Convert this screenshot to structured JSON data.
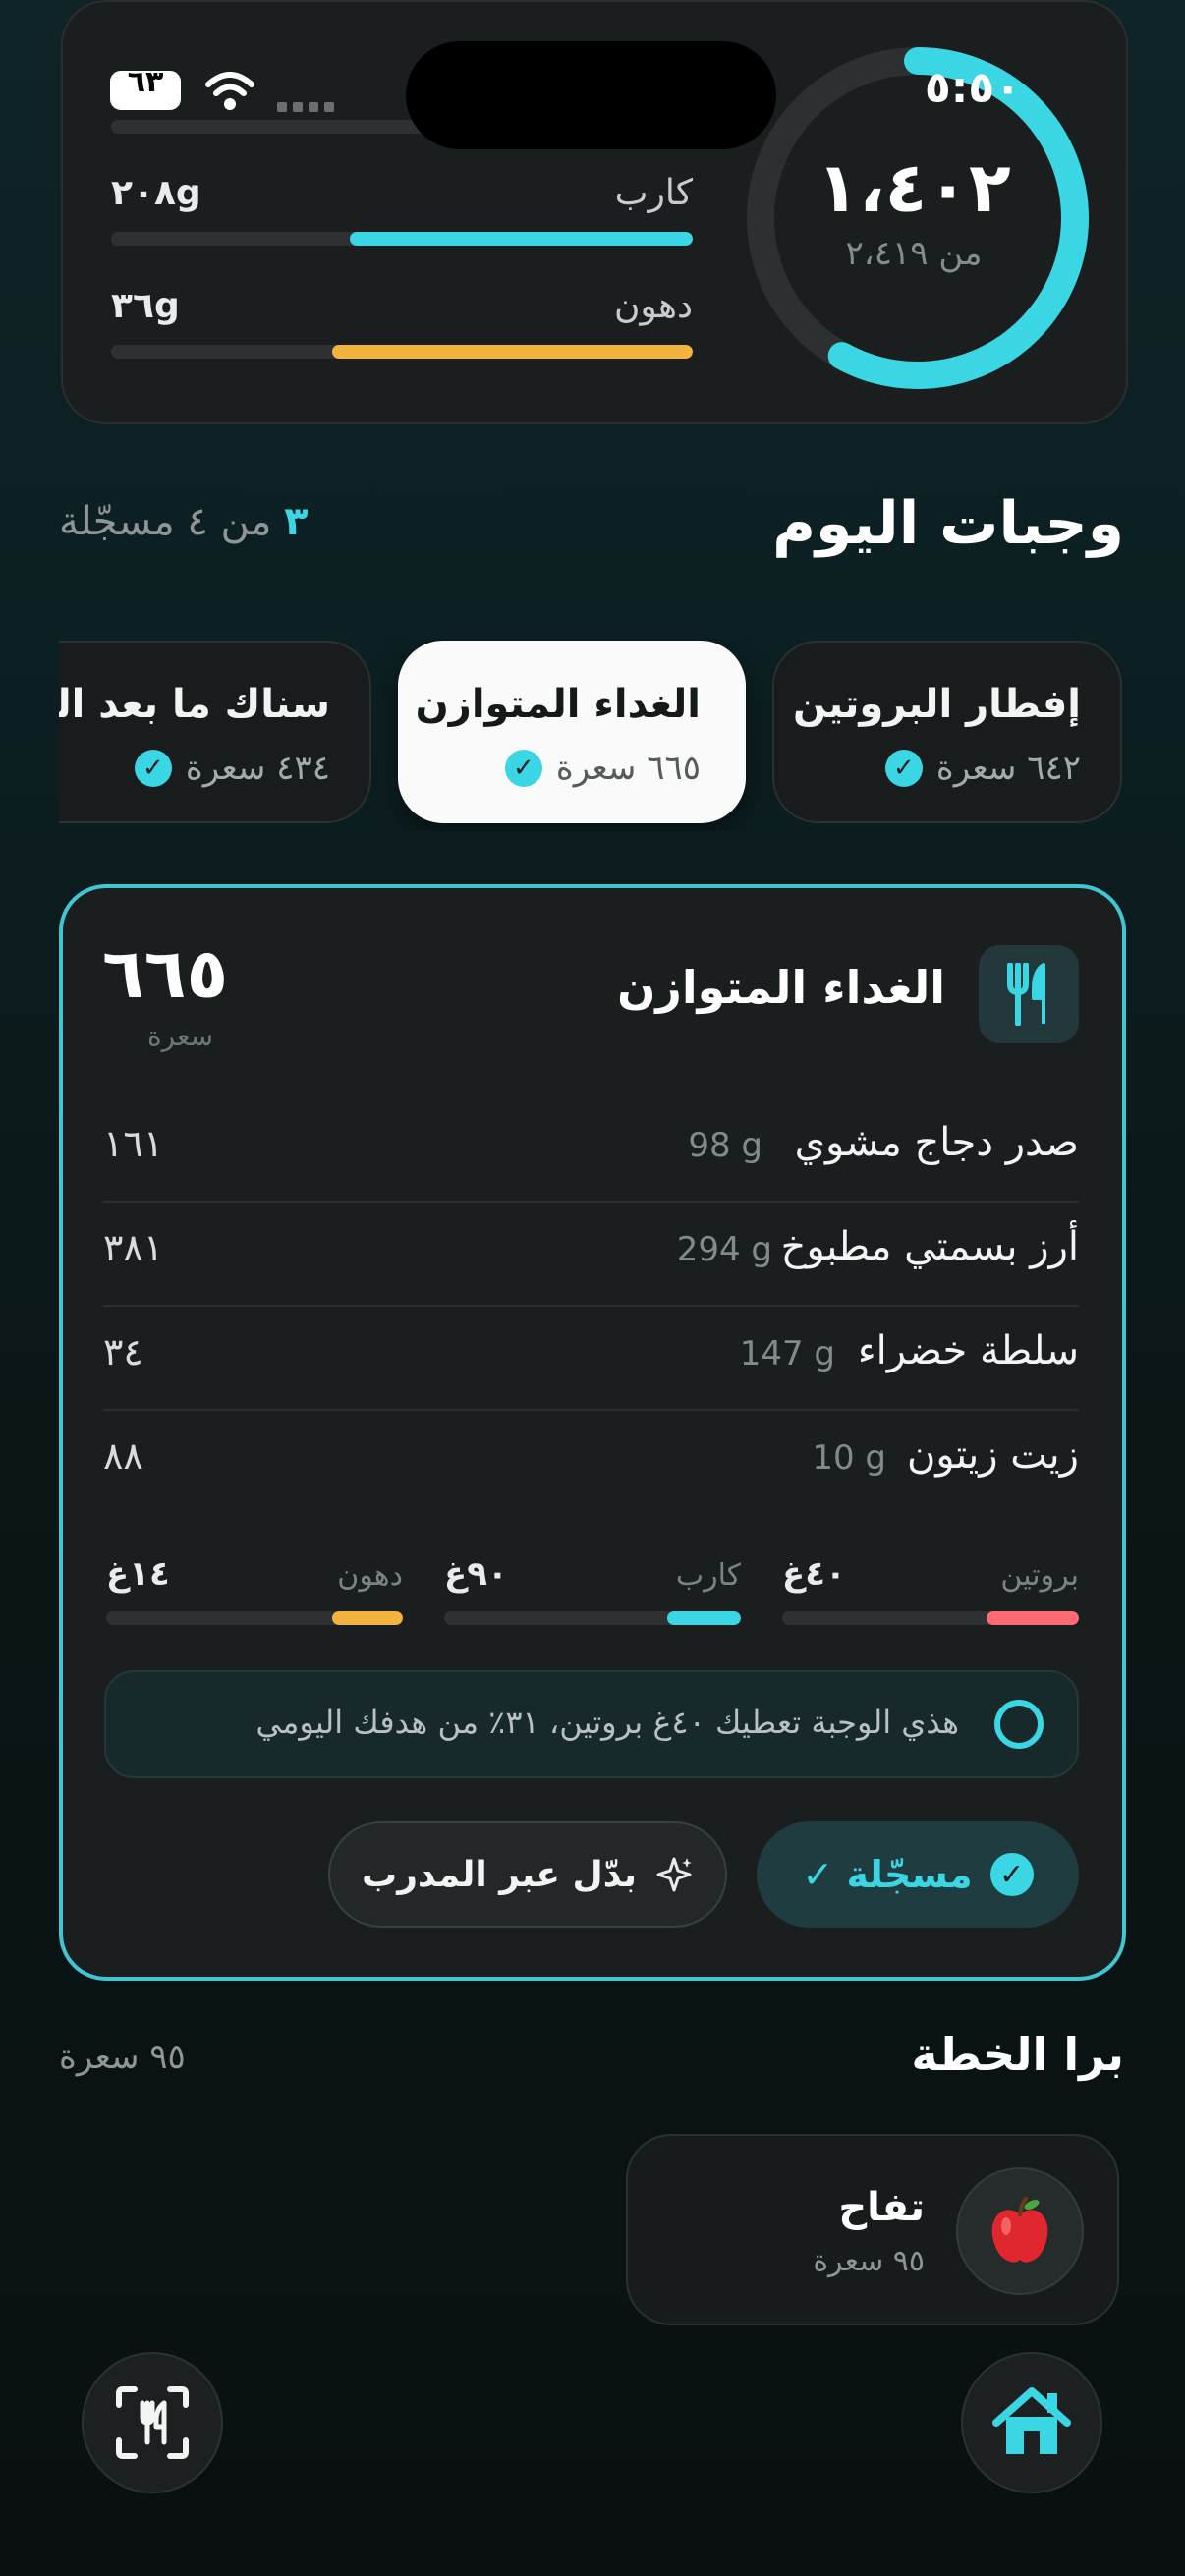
{
  "status": {
    "time": "٥:٥٠",
    "battery": "٦٣"
  },
  "summary": {
    "calories_value": "١،٤٠٢",
    "calories_target": "من ٢،٤١٩",
    "calories_progress": 0.58,
    "macros": [
      {
        "label": "كارب",
        "value": "٢٠٨g",
        "fill": 0.59,
        "color": "#3ad6e4"
      },
      {
        "label": "دهون",
        "value": "٣٦g",
        "fill": 0.62,
        "color": "#f2b43f"
      }
    ],
    "protein_bar_color": "#ff6b74"
  },
  "today": {
    "title": "وجبات اليوم",
    "count_number": "٣",
    "count_text": "من ٤ مسجّلة"
  },
  "meal_tabs": [
    {
      "title": "إفطار البروتين",
      "calories": "٦٤٢ سعرة",
      "checked": true,
      "active": false
    },
    {
      "title": "الغداء المتوازن",
      "calories": "٦٦٥ سعرة",
      "checked": true,
      "active": true
    },
    {
      "title": "سناك ما بعد التمرين",
      "calories": "٤٣٤ سعرة",
      "checked": true,
      "active": false
    }
  ],
  "meal": {
    "icon": "fork-knife-icon",
    "title": "الغداء المتوازن",
    "calories": "٦٦٥",
    "calories_unit": "سعرة",
    "foods": [
      {
        "name": "صدر دجاج مشوي",
        "grams": "98 g",
        "calories": "١٦١"
      },
      {
        "name": "أرز بسمتي مطبوخ",
        "grams": "294 g",
        "calories": "٣٨١"
      },
      {
        "name": "سلطة خضراء",
        "grams": "147 g",
        "calories": "٣٤"
      },
      {
        "name": "زيت زيتون",
        "grams": "10 g",
        "calories": "٨٨"
      }
    ],
    "macros": [
      {
        "label": "بروتين",
        "value": "٤٠غ",
        "fill": 0.31,
        "color": "#ff6b74"
      },
      {
        "label": "كارب",
        "value": "٩٠غ",
        "fill": 0.25,
        "color": "#3ad6e4"
      },
      {
        "label": "دهون",
        "value": "١٤غ",
        "fill": 0.24,
        "color": "#f2b43f"
      }
    ],
    "insight": "هذي الوجبة تعطيك ٤٠غ بروتين، ٣١٪ من هدفك اليومي",
    "logged_label": "مسجّلة ✓",
    "swap_label": "بدّل عبر المدرب"
  },
  "extras": {
    "title": "برا الخطة",
    "total": "٩٥ سعرة",
    "items": [
      {
        "name": "تفاح",
        "calories": "٩٥ سعرة",
        "emoji": "🍎"
      }
    ]
  },
  "nav": {
    "left_icon": "scan-food-icon",
    "right_icon": "home-icon"
  },
  "colors": {
    "accent": "#3ad6e4",
    "protein": "#ff6b74",
    "fat": "#f2b43f"
  }
}
